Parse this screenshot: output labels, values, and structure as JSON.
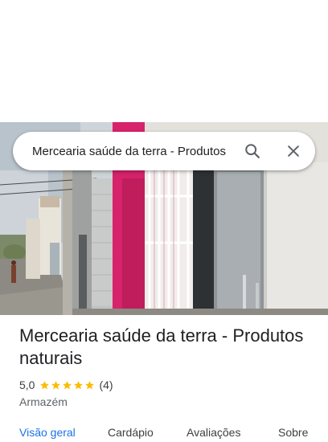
{
  "search": {
    "value": "Mercearia saúde da terra - Produtos naturais"
  },
  "place": {
    "name": "Mercearia saúde da terra - Produtos naturais",
    "rating": "5,0",
    "stars": 5,
    "review_count": "(4)",
    "category": "Armazém"
  },
  "tabs": [
    {
      "label": "Visão geral",
      "active": true
    },
    {
      "label": "Cardápio",
      "active": false
    },
    {
      "label": "Avaliações",
      "active": false
    },
    {
      "label": "Sobre",
      "active": false
    }
  ],
  "colors": {
    "accent": "#1a73e8",
    "star": "#fbbc04",
    "storefront_pink": "#d6236b"
  },
  "icons": {
    "search": "search-icon",
    "close": "close-icon",
    "star": "star-icon"
  }
}
